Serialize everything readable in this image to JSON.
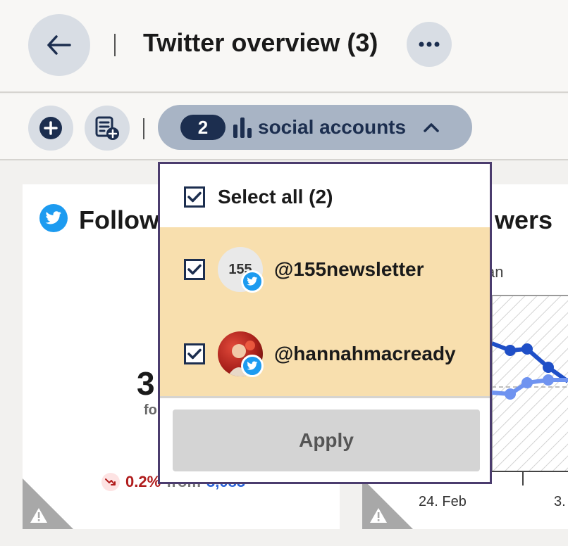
{
  "header": {
    "title": "Twitter overview (3)",
    "back_icon": "arrow-left-icon",
    "more_icon": "more-horizontal-icon"
  },
  "toolbar": {
    "add_icon": "plus-circle-icon",
    "add_report_icon": "report-add-icon",
    "accounts_filter": {
      "count": "2",
      "label": "social accounts",
      "icon": "bar-chart-icon",
      "expanded_icon": "chevron-up-icon"
    }
  },
  "dropdown": {
    "select_all_label": "Select all (2)",
    "select_all_checked": true,
    "accounts": [
      {
        "handle": "@155newsletter",
        "avatar_text": "155",
        "network": "twitter",
        "checked": true
      },
      {
        "handle": "@hannahmacready",
        "network": "twitter",
        "checked": true
      }
    ],
    "apply_label": "Apply"
  },
  "cards": {
    "left": {
      "title": "Follow",
      "icon": "twitter-icon",
      "big_number": "3",
      "big_sub": "fo",
      "change_pct": "0.2%",
      "change_from": "from",
      "change_prev": "3,083",
      "change_icon": "trend-down-icon",
      "warning_icon": "warning-icon"
    },
    "right": {
      "title": "wers",
      "subtitle": "an",
      "x_ticks": [
        "24. Feb",
        "3."
      ],
      "warning_icon": "warning-icon"
    }
  },
  "colors": {
    "accent_dark": "#1c2e4f",
    "pill_bg": "#a8b4c5",
    "selected_bg": "#f8dfae",
    "twitter": "#1d9bf0",
    "negative": "#b01c1c",
    "series_dark": "#1f4fc7",
    "series_light": "#6f93f0"
  }
}
